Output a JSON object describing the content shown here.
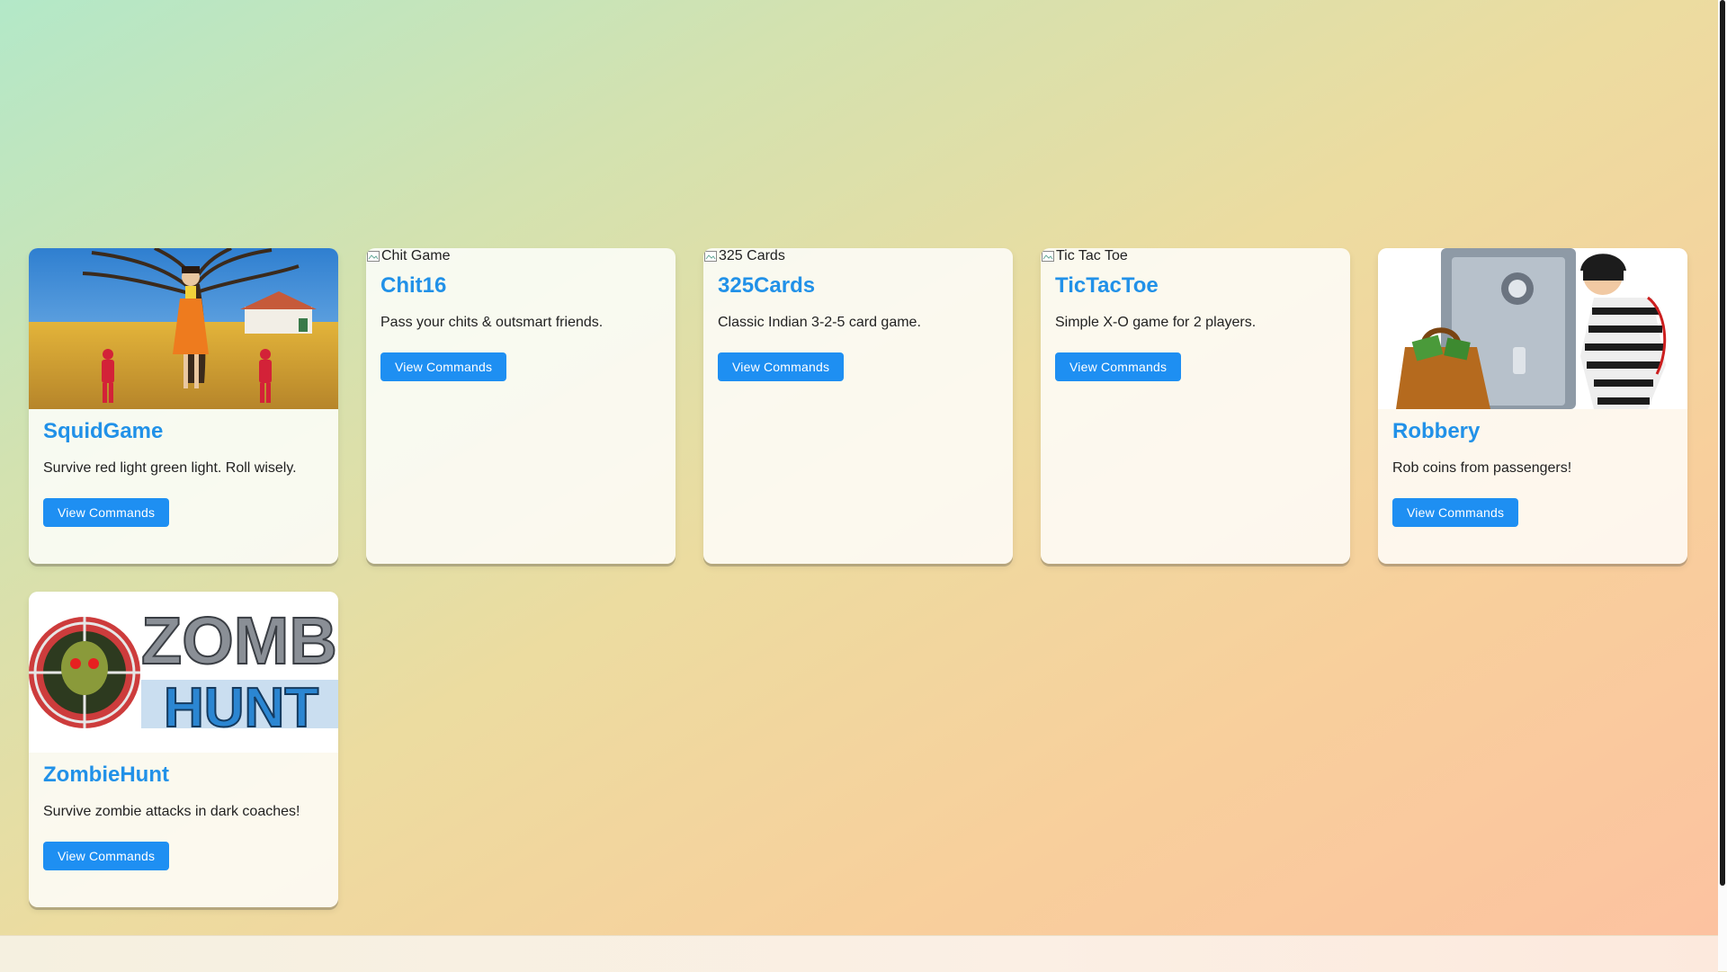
{
  "games": [
    {
      "key": "squid",
      "title": "SquidGame",
      "description": "Survive red light green light. Roll wisely.",
      "button": "View Commands",
      "image_alt": "",
      "image_loaded": true
    },
    {
      "key": "chit",
      "title": "Chit16",
      "description": "Pass your chits & outsmart friends.",
      "button": "View Commands",
      "image_alt": "Chit Game",
      "image_loaded": false
    },
    {
      "key": "cards",
      "title": "325Cards",
      "description": "Classic Indian 3-2-5 card game.",
      "button": "View Commands",
      "image_alt": "325 Cards",
      "image_loaded": false
    },
    {
      "key": "ttt",
      "title": "TicTacToe",
      "description": "Simple X-O game for 2 players.",
      "button": "View Commands",
      "image_alt": "Tic Tac Toe",
      "image_loaded": false
    },
    {
      "key": "robbery",
      "title": "Robbery",
      "description": "Rob coins from passengers!",
      "button": "View Commands",
      "image_alt": "",
      "image_loaded": true
    },
    {
      "key": "zombie",
      "title": "ZombieHunt",
      "description": "Survive zombie attacks in dark coaches!",
      "button": "View Commands",
      "image_alt": "",
      "image_loaded": true
    }
  ],
  "images": {
    "zombie_logo_line1": "ZOMBIE",
    "zombie_logo_line2": "HUNT"
  },
  "colors": {
    "accent": "#2191e8",
    "button": "#1e8ff2"
  }
}
